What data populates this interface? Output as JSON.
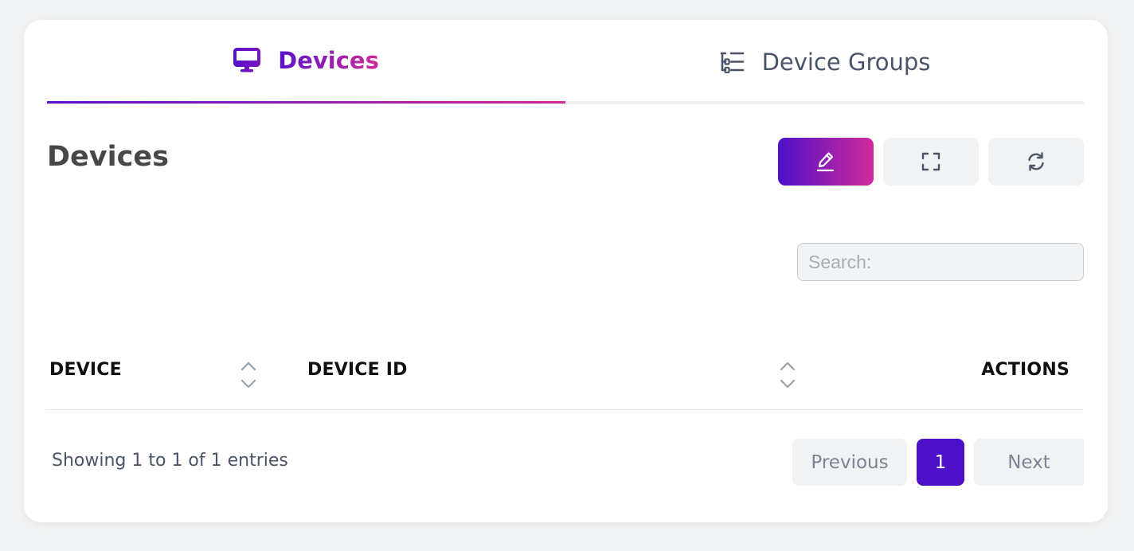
{
  "tabs": [
    {
      "label": "Devices",
      "icon": "monitor-icon",
      "active": true
    },
    {
      "label": "Device Groups",
      "icon": "list-tree-icon",
      "active": false
    }
  ],
  "page": {
    "title": "Devices"
  },
  "toolbar": {
    "edit_icon": "pencil-icon",
    "fullscreen_icon": "fullscreen-icon",
    "refresh_icon": "refresh-icon"
  },
  "search": {
    "placeholder": "Search:",
    "value": ""
  },
  "table": {
    "columns": [
      "DEVICE",
      "DEVICE ID",
      "ACTIONS"
    ],
    "rows": []
  },
  "footer": {
    "info": "Showing 1 to 1 of 1 entries",
    "previous_label": "Previous",
    "current_page": "1",
    "next_label": "Next"
  },
  "colors": {
    "gradient_start": "#4d10c9",
    "gradient_end": "#d2299a",
    "page_active": "#4d10c9",
    "button_bg": "#f1f2f3"
  }
}
